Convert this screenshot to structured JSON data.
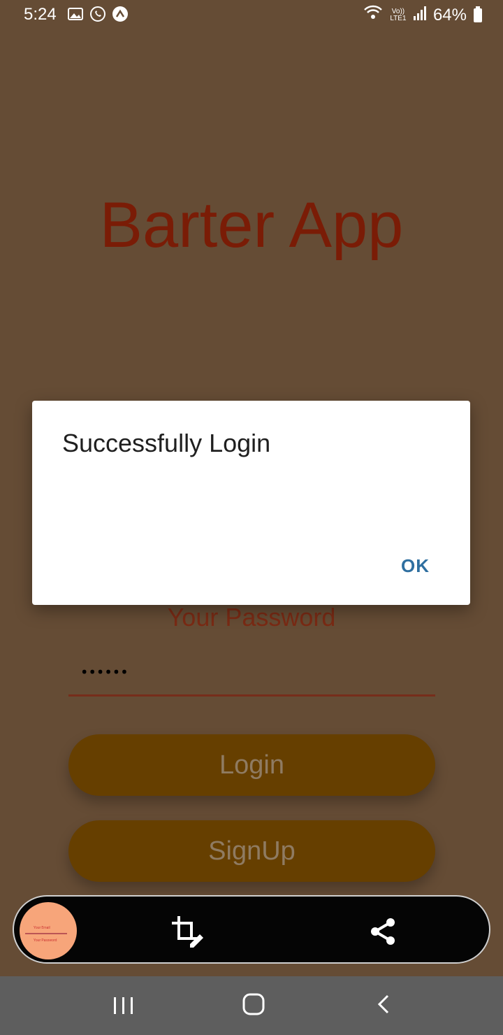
{
  "status_bar": {
    "time": "5:24",
    "battery": "64%",
    "network_label": "Vo)) LTE1"
  },
  "app": {
    "title": "Barter App",
    "password_label": "Your Password",
    "password_value": "••••••",
    "login_label": "Login",
    "signup_label": "SignUp"
  },
  "dialog": {
    "message": "Successfully Login",
    "ok_label": "OK"
  },
  "screenshot_toolbar": {
    "thumbnail_texts": [
      "Your Email",
      "Your Password"
    ],
    "icons": [
      "crop-edit-icon",
      "share-icon"
    ]
  },
  "nav_bar": {
    "icons": [
      "recent-apps-icon",
      "home-icon",
      "back-icon"
    ]
  },
  "colors": {
    "background": "#654c35",
    "title": "#7a1c06",
    "button": "#663f00",
    "dialog_button": "#2f6fa0"
  }
}
